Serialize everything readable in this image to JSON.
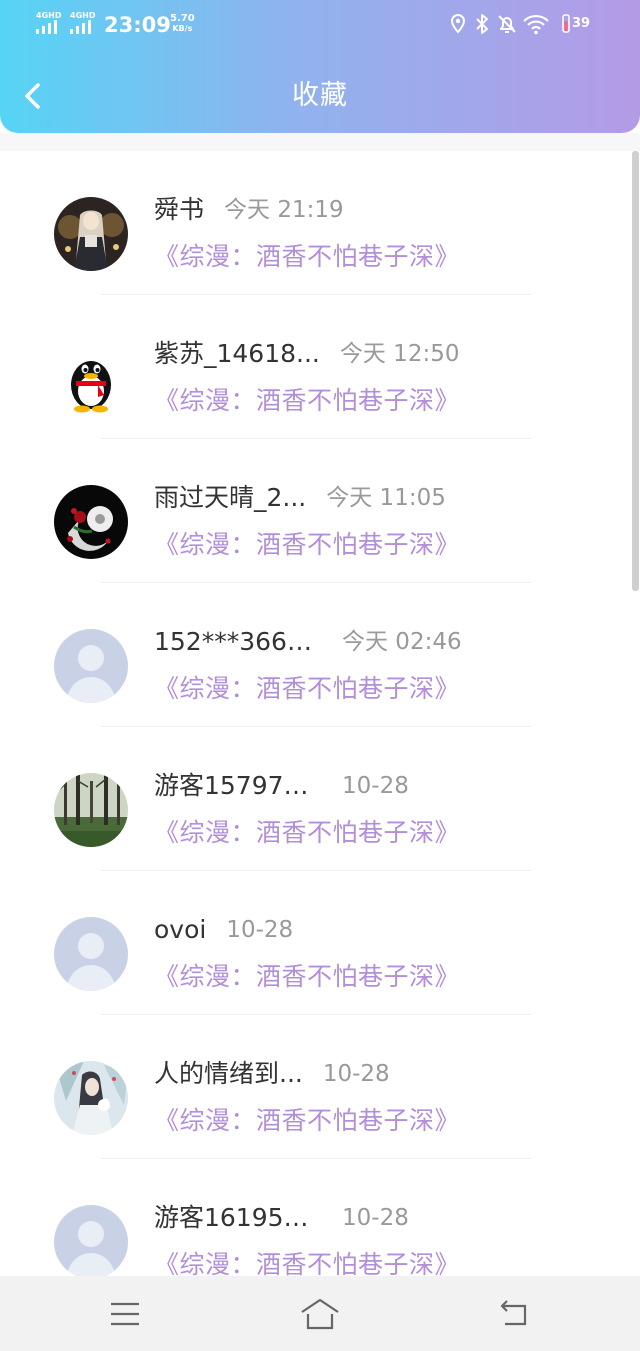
{
  "status_bar": {
    "sim1": "4GHD",
    "sim2": "4GHD",
    "time": "23:09",
    "speed_value": "5.70",
    "speed_unit": "KB/s",
    "battery": "39",
    "icons": [
      "location-icon",
      "bluetooth-icon",
      "mute-bell-icon",
      "wifi-icon",
      "battery-icon"
    ]
  },
  "header": {
    "title": "收藏",
    "back_icon": "chevron-left-icon"
  },
  "colors": {
    "header_gradient": [
      "#56d4f5",
      "#b49be6"
    ],
    "novel_title": "#b18fd9",
    "username": "#333333",
    "timestamp": "#999999"
  },
  "favorites": [
    {
      "username": "舜书",
      "time": "今天 21:19",
      "novel": "《综漫：酒香不怕巷子深》",
      "avatar": "anime-girl-avatar"
    },
    {
      "username": "紫苏_14618...",
      "time": "今天 12:50",
      "novel": "《综漫：酒香不怕巷子深》",
      "avatar": "qq-penguin-avatar"
    },
    {
      "username": "雨过天晴_2...",
      "time": "今天 11:05",
      "novel": "《综漫：酒香不怕巷子深》",
      "avatar": "rose-flower-avatar"
    },
    {
      "username": "152***366_...",
      "time": "今天 02:46",
      "novel": "《综漫：酒香不怕巷子深》",
      "avatar": "default-person-avatar"
    },
    {
      "username": "游客157979...",
      "time": "10-28",
      "novel": "《综漫：酒香不怕巷子深》",
      "avatar": "forest-avatar"
    },
    {
      "username": "ovoi",
      "time": "10-28",
      "novel": "《综漫：酒香不怕巷子深》",
      "avatar": "default-person-avatar"
    },
    {
      "username": "人的情绪到...",
      "time": "10-28",
      "novel": "《综漫：酒香不怕巷子深》",
      "avatar": "ink-painting-girl-avatar"
    },
    {
      "username": "游客161952...",
      "time": "10-28",
      "novel": "《综漫：酒香不怕巷子深》",
      "avatar": "default-person-avatar"
    }
  ],
  "nav_bar": {
    "icons": [
      "menu-icon",
      "home-icon",
      "back-icon"
    ]
  }
}
